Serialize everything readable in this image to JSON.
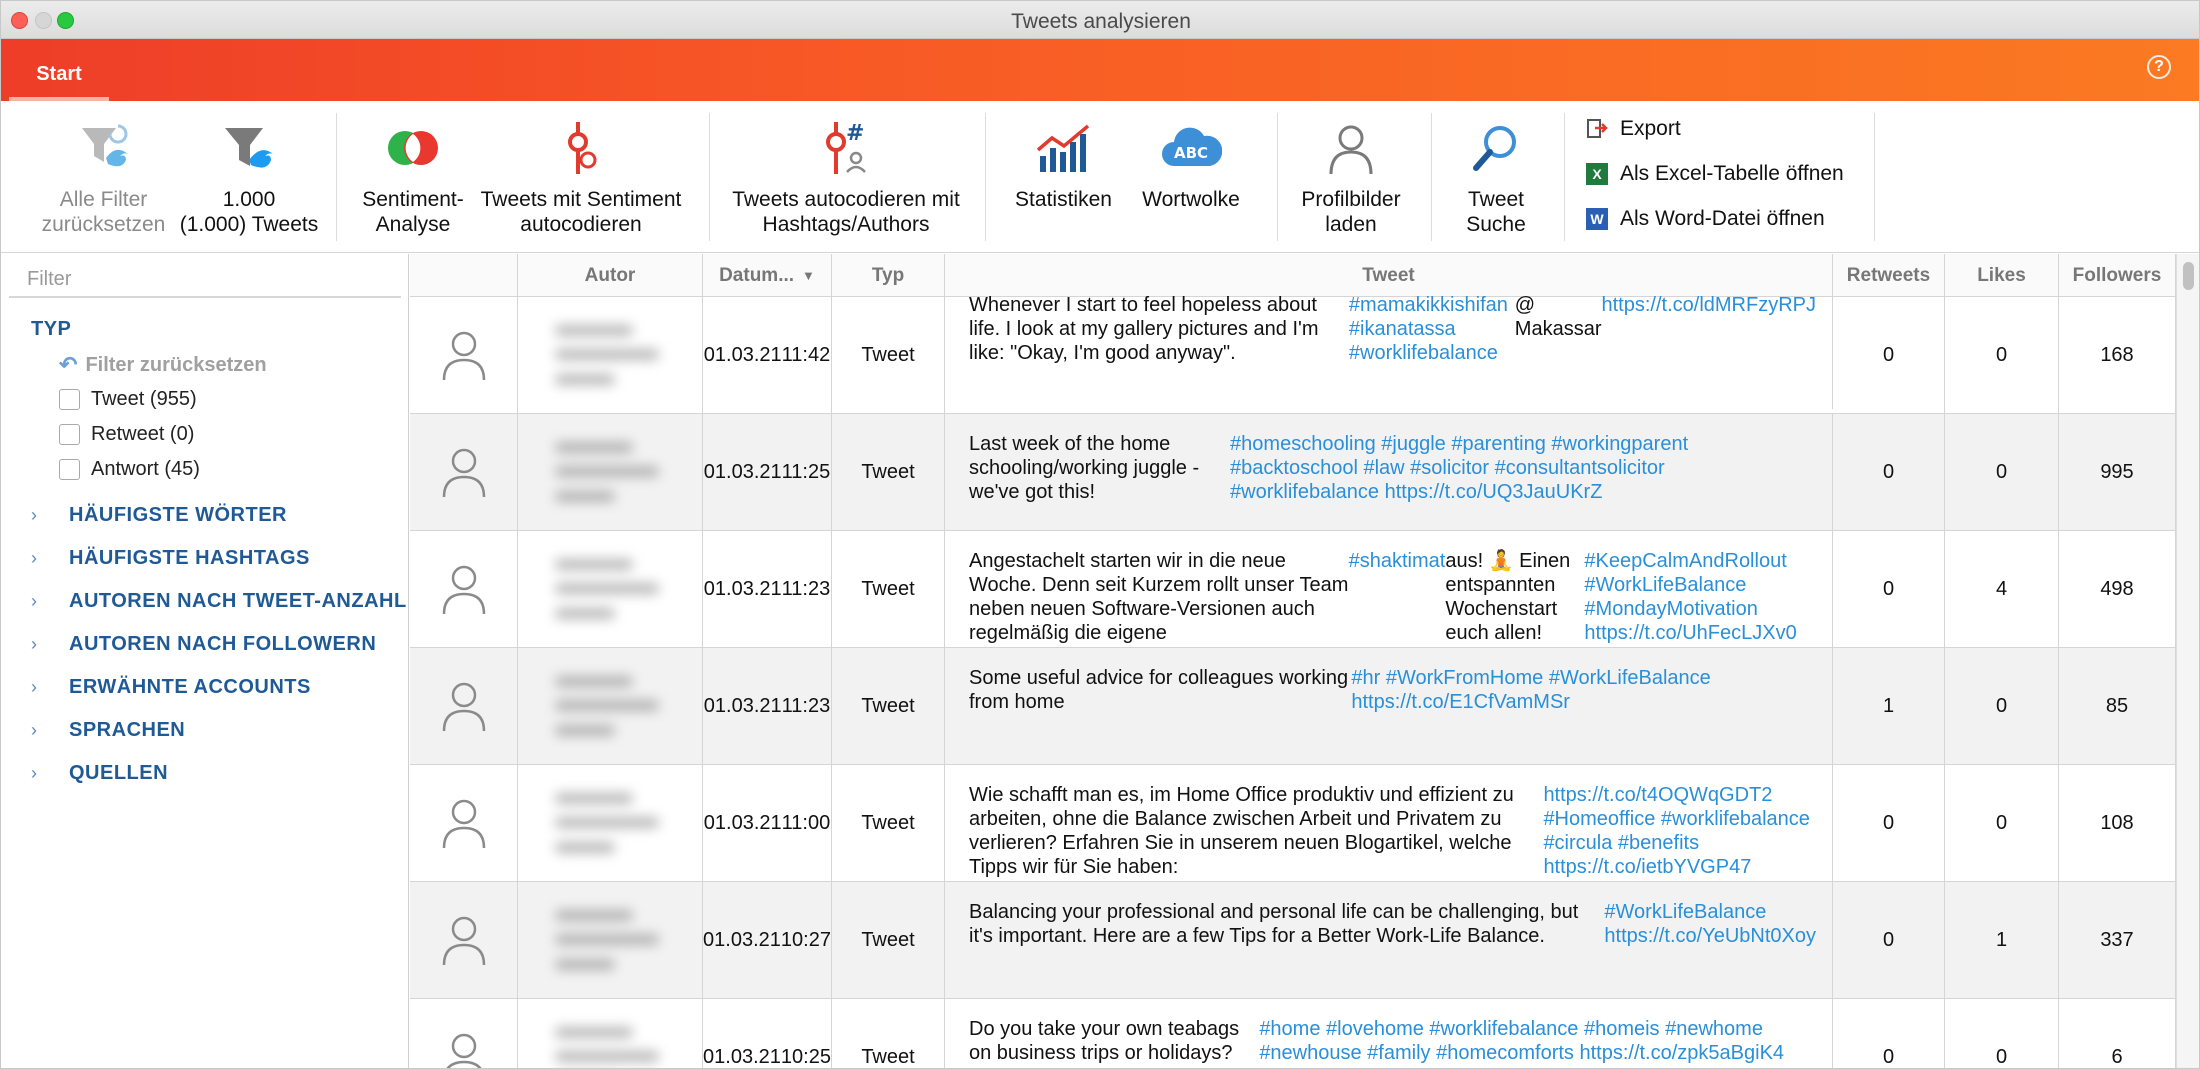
{
  "window": {
    "title": "Tweets analysieren"
  },
  "ribbon": {
    "tab": "Start",
    "help": "?"
  },
  "toolbar": {
    "reset_filters": {
      "line1": "Alle Filter",
      "line2": "zurücksetzen"
    },
    "tweet_count": {
      "line1": "1.000",
      "line2": "(1.000) Tweets"
    },
    "sentiment": {
      "line1": "Sentiment-",
      "line2": "Analyse"
    },
    "autocode_sentiment": {
      "line1": "Tweets mit Sentiment",
      "line2": "autocodieren"
    },
    "autocode_hashtags": {
      "line1": "Tweets autocodieren mit",
      "line2": "Hashtags/Authors"
    },
    "stats": {
      "line1": "Statistiken"
    },
    "wordcloud": {
      "line1": "Wortwolke"
    },
    "profile_pics": {
      "line1": "Profilbilder",
      "line2": "laden"
    },
    "tweet_search": {
      "line1": "Tweet",
      "line2": "Suche"
    },
    "export_label": "Export",
    "excel_label": "Als Excel-Tabelle öffnen",
    "word_label": "Als Word-Datei öffnen",
    "wordcloud_badge": "ABC"
  },
  "sidebar": {
    "filter_placeholder": "Filter",
    "type_heading": "TYP",
    "reset_label": "Filter zurücksetzen",
    "checkboxes": [
      "Tweet (955)",
      "Retweet (0)",
      "Antwort (45)"
    ],
    "sections": [
      "HÄUFIGSTE WÖRTER",
      "HÄUFIGSTE HASHTAGS",
      "AUTOREN NACH TWEET-ANZAHL",
      "AUTOREN NACH FOLLOWERN",
      "ERWÄHNTE ACCOUNTS",
      "SPRACHEN",
      "QUELLEN"
    ]
  },
  "table": {
    "headers": {
      "autor": "Autor",
      "datum": "Datum...",
      "typ": "Typ",
      "tweet": "Tweet",
      "retweets": "Retweets",
      "likes": "Likes",
      "followers": "Followers"
    },
    "rows": [
      {
        "date": "01.03.21",
        "time": "11:42",
        "type": "Tweet",
        "retweets": "0",
        "likes": "0",
        "followers": "168"
      },
      {
        "date": "01.03.21",
        "time": "11:25",
        "type": "Tweet",
        "retweets": "0",
        "likes": "0",
        "followers": "995"
      },
      {
        "date": "01.03.21",
        "time": "11:23",
        "type": "Tweet",
        "retweets": "0",
        "likes": "4",
        "followers": "498"
      },
      {
        "date": "01.03.21",
        "time": "11:23",
        "type": "Tweet",
        "retweets": "1",
        "likes": "0",
        "followers": "85"
      },
      {
        "date": "01.03.21",
        "time": "11:00",
        "type": "Tweet",
        "retweets": "0",
        "likes": "0",
        "followers": "108"
      },
      {
        "date": "01.03.21",
        "time": "10:27",
        "type": "Tweet",
        "retweets": "0",
        "likes": "1",
        "followers": "337"
      },
      {
        "date": "01.03.21",
        "time": "10:25",
        "type": "Tweet",
        "retweets": "0",
        "likes": "0",
        "followers": "6"
      }
    ],
    "tweets": [
      [
        [
          "Whenever I start to feel hopeless about life. I look at my gallery pictures and I'm like: \"Okay, I'm good anyway\". ",
          0
        ],
        [
          "#mamakikkishifan #ikanatassa #worklifebalance",
          1
        ],
        [
          " @ Makassar ",
          0
        ],
        [
          "https://t.co/ldMRFzyRPJ",
          1
        ]
      ],
      [
        [
          "Last week of the home schooling/working juggle - we've got this! ",
          0
        ],
        [
          "#homeschooling #juggle #parenting #workingparent #backtoschool #law #solicitor #consultantsolicitor #worklifebalance https://t.co/UQ3JauUKrZ",
          1
        ]
      ],
      [
        [
          "Angestachelt starten wir in die neue Woche. Denn seit Kurzem rollt unser Team neben neuen Software-Versionen auch regelmäßig die eigene ",
          0
        ],
        [
          "#shaktimat",
          1
        ],
        [
          " aus! 🧘 Einen entspannten Wochenstart euch allen! ",
          0
        ],
        [
          "#KeepCalmAndRollout #WorkLifeBalance #MondayMotivation https://t.co/UhFecLJXv0",
          1
        ]
      ],
      [
        [
          "Some useful advice for colleagues working from home ",
          0
        ],
        [
          "#hr #WorkFromHome #WorkLifeBalance https://t.co/E1CfVamMSr",
          1
        ]
      ],
      [
        [
          "Wie schafft man es, im Home Office produktiv und effizient zu arbeiten, ohne die Balance zwischen Arbeit und Privatem zu verlieren? Erfahren Sie in unserem neuen Blogartikel, welche Tipps wir für Sie haben: ",
          0
        ],
        [
          "https://t.co/t4OQWqGDT2 #Homeoffice #worklifebalance #circula #benefits https://t.co/ietbYVGP47",
          1
        ]
      ],
      [
        [
          "Balancing your professional and personal life can be challenging, but it's important. Here are a few Tips for a Better Work-Life Balance. ",
          0
        ],
        [
          "#WorkLifeBalance https://t.co/YeUbNt0Xoy",
          1
        ]
      ],
      [
        [
          "Do you take your own teabags on business trips or holidays? ",
          0
        ],
        [
          "#home #lovehome #worklifebalance #homeis #newhome #newhouse #family #homecomforts https://t.co/zpk5aBgiK4",
          1
        ]
      ]
    ]
  },
  "colors": {
    "accent_start": "#ee3d28",
    "accent_end": "#fb7a22",
    "hashtag": "#2a8fd9",
    "section": "#1f5a96"
  }
}
